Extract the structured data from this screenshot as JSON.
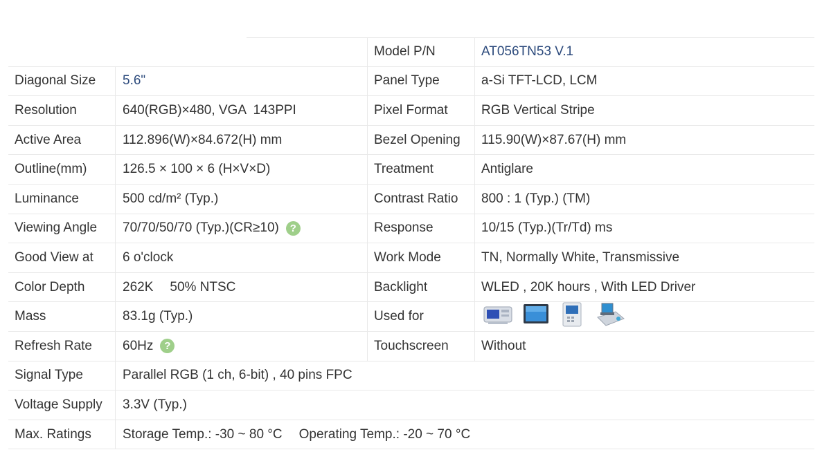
{
  "rows": [
    {
      "l1": "",
      "v1": "",
      "l2": "Model P/N",
      "v2": "AT056TN53 V.1"
    },
    {
      "l1": "Diagonal Size",
      "v1": "5.6\"",
      "l2": "Panel Type",
      "v2": "a-Si TFT-LCD, LCM"
    },
    {
      "l1": "Resolution",
      "v1": "640(RGB)×480, VGA  143PPI",
      "l2": "Pixel Format",
      "v2": "RGB Vertical Stripe"
    },
    {
      "l1": "Active Area",
      "v1": "112.896(W)×84.672(H) mm",
      "l2": "Bezel Opening",
      "v2": "115.90(W)×87.67(H) mm"
    },
    {
      "l1": "Outline(mm)",
      "v1": "126.5 × 100 × 6 (H×V×D)",
      "l2": "Treatment",
      "v2": "Antiglare"
    },
    {
      "l1": "Luminance",
      "v1": "500 cd/m² (Typ.)",
      "l2": "Contrast Ratio",
      "v2": "800 : 1 (Typ.) (TM)"
    },
    {
      "l1": "Viewing Angle",
      "v1": "70/70/50/70 (Typ.)(CR≥10)",
      "l2": "Response",
      "v2": "10/15 (Typ.)(Tr/Td) ms"
    },
    {
      "l1": "Good View at",
      "v1": "6 o'clock",
      "l2": "Work Mode",
      "v2": "TN, Normally White, Transmissive"
    },
    {
      "l1": "Color Depth",
      "v1a": "262K",
      "v1b": "50% NTSC",
      "l2": "Backlight",
      "v2": "WLED , 20K hours , With LED Driver"
    },
    {
      "l1": "Mass",
      "v1": "83.1g (Typ.)",
      "l2": "Used for",
      "v2": ""
    },
    {
      "l1": "Refresh Rate",
      "v1": "60Hz",
      "l2": "Touchscreen",
      "v2": "Without"
    },
    {
      "l1": "Signal Type",
      "v1": "Parallel RGB (1 ch, 6-bit) , 40 pins FPC"
    },
    {
      "l1": "Voltage Supply",
      "v1": "3.3V (Typ.)"
    },
    {
      "l1": "Max. Ratings",
      "v1a": "Storage Temp.: -30 ~ 80 °C",
      "v1b": "Operating Temp.: -20 ~ 70 °C"
    }
  ],
  "help_glyph": "?",
  "used_for_icons": [
    "ultrasound-device-icon",
    "monitor-icon",
    "intercom-terminal-icon",
    "pos-terminal-icon"
  ],
  "colors": {
    "link_blue": "#2c4a7c",
    "help_green": "#9fcf8a",
    "border": "#e9e9e9",
    "text": "#333333"
  }
}
